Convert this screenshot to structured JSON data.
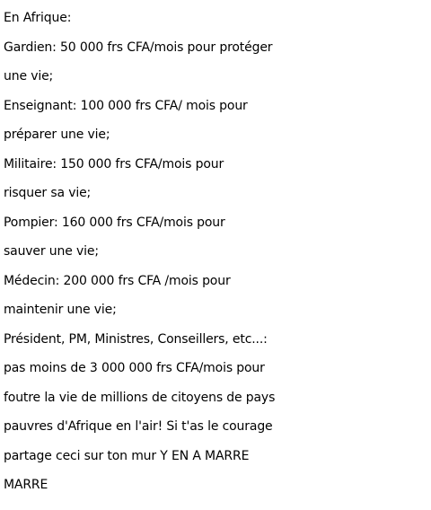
{
  "text": {
    "lines": [
      "En Afrique:",
      "Gardien: 50 000 frs CFA/mois pour protéger",
      "une vie;",
      "Enseignant: 100 000 frs CFA/ mois pour",
      "préparer une vie;",
      "Militaire: 150 000 frs CFA/mois pour",
      "risquer sa vie;",
      "Pompier: 160 000 frs CFA/mois pour",
      "sauver une vie;",
      "Médecin: 200 000 frs CFA /mois pour",
      "maintenir une vie;",
      "Président, PM, Ministres, Conseillers, etc...:",
      "pas moins de 3 000 000 frs CFA/mois pour",
      "foutre la vie de millions de citoyens de pays",
      "pauvres d'Afrique en l'air! Si t'as le courage",
      "partage ceci sur ton mur Y EN A MARRE",
      "MARRE"
    ]
  }
}
